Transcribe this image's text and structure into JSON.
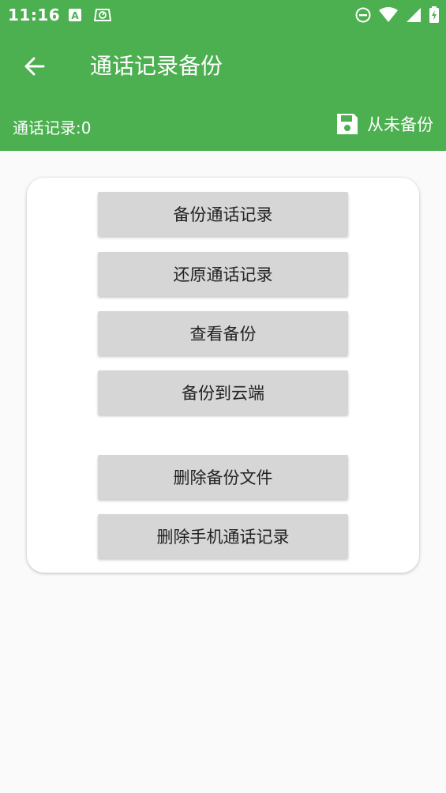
{
  "status_bar": {
    "time": "11:16",
    "icons_left": [
      "a-notification-icon",
      "speed-meter-icon"
    ],
    "icons_right": [
      "do-not-disturb-icon",
      "wifi-icon",
      "cell-signal-icon",
      "battery-icon"
    ]
  },
  "app_bar": {
    "title": "通话记录备份"
  },
  "info_bar": {
    "record_count": "通话记录:0",
    "backup_status": "从未备份"
  },
  "buttons": {
    "backup": "备份通话记录",
    "restore": "还原通话记录",
    "view": "查看备份",
    "cloud": "备份到云端",
    "delete_backup": "删除备份文件",
    "delete_phone": "删除手机通话记录"
  },
  "colors": {
    "primary": "#4caf50",
    "background": "#fafafa",
    "button": "#d6d6d6"
  }
}
